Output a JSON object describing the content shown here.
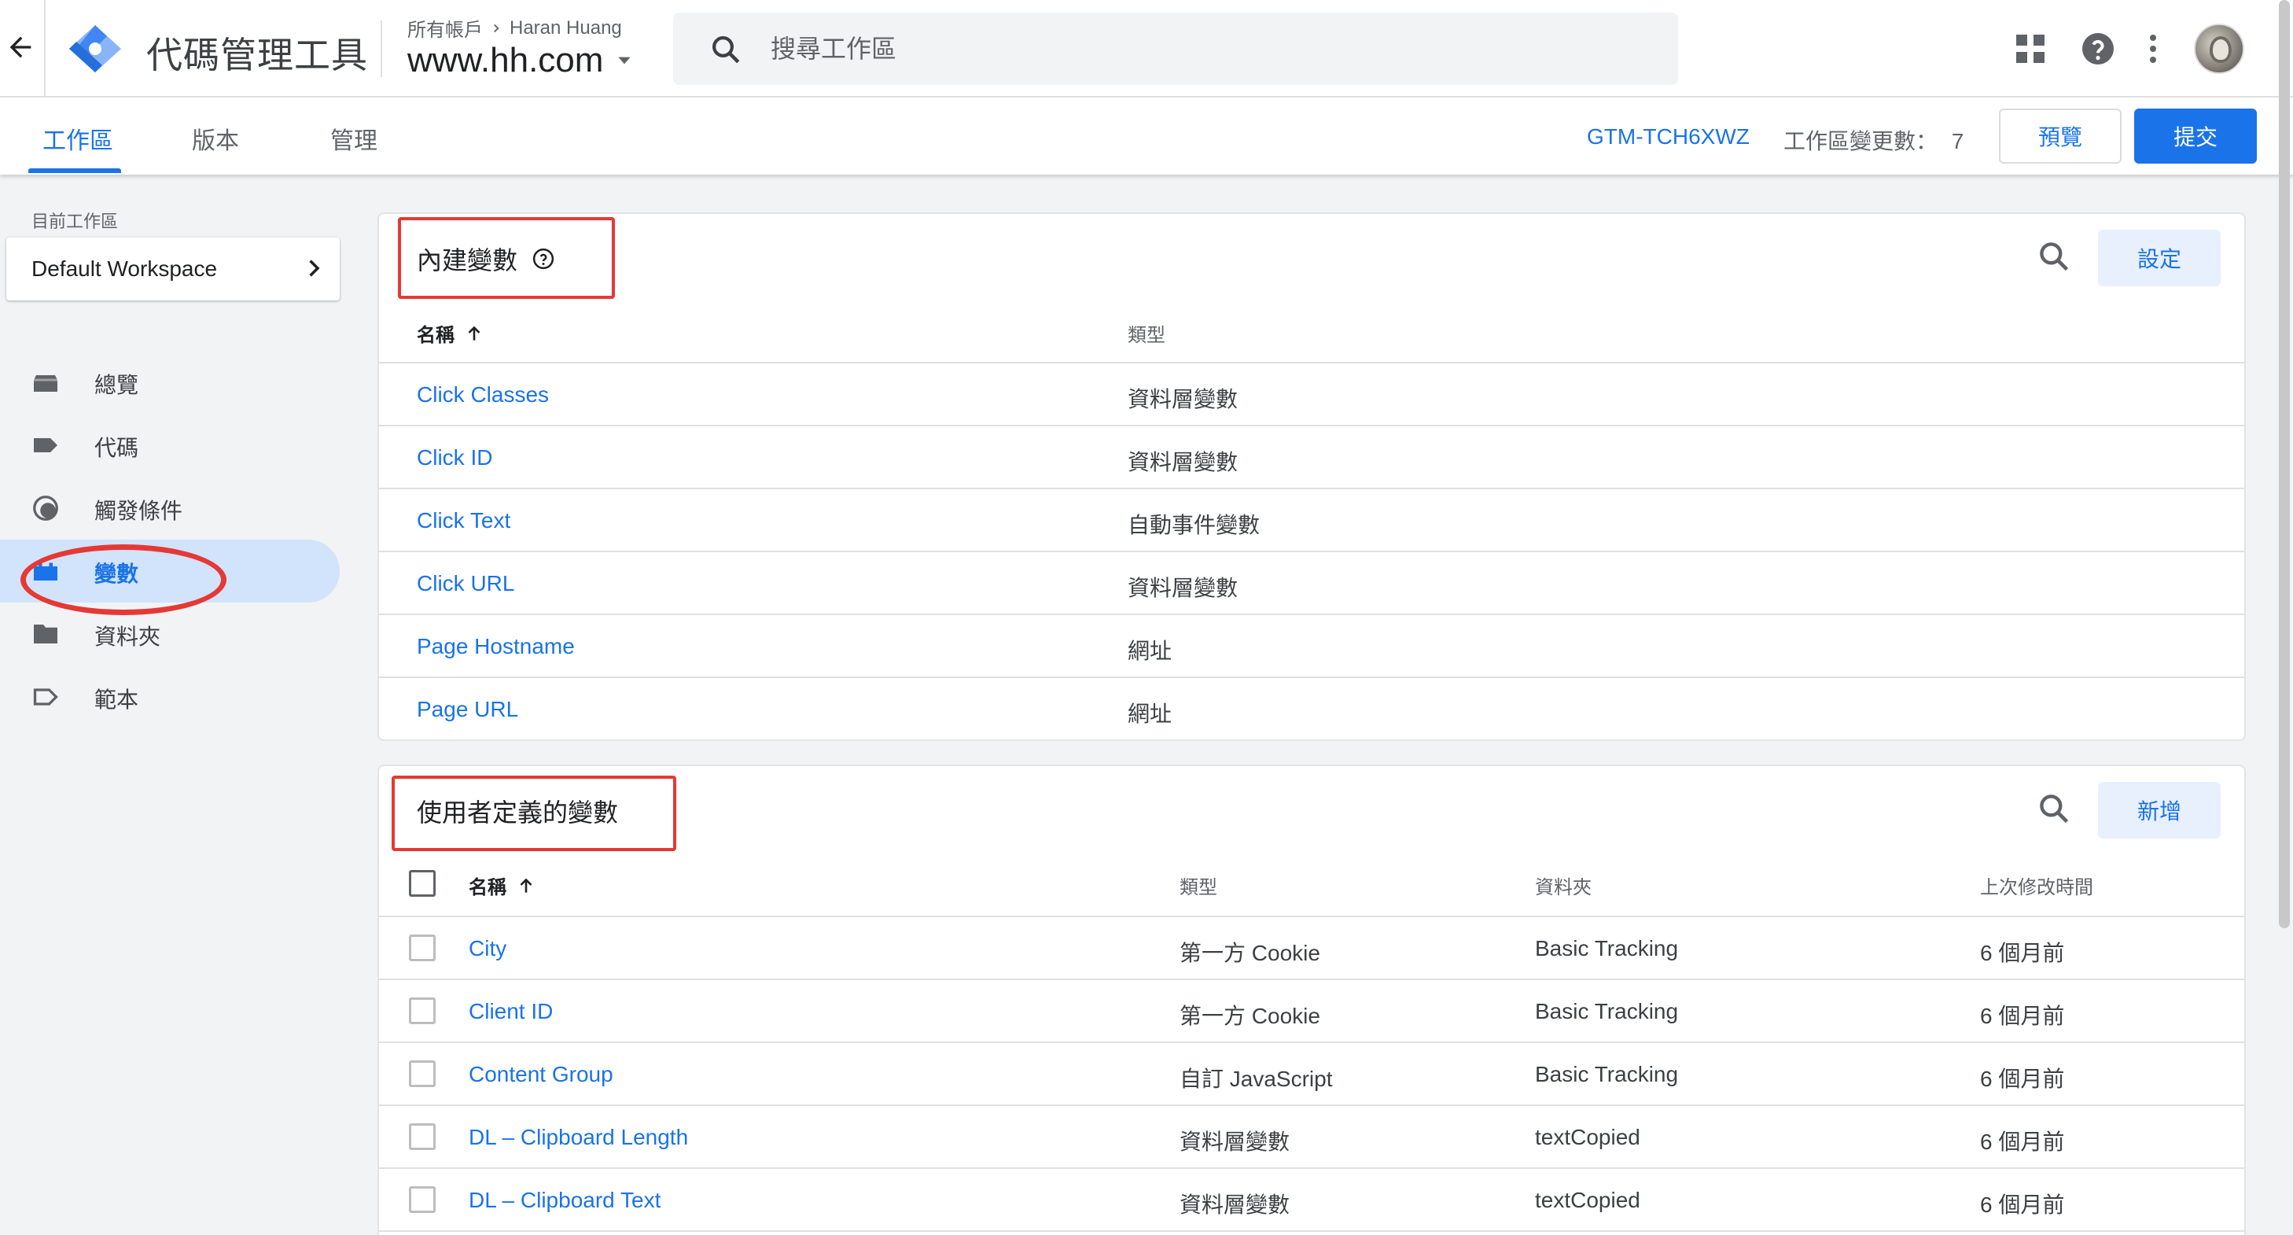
{
  "header": {
    "app_title": "代碼管理工具",
    "breadcrumb_all_accounts": "所有帳戶",
    "breadcrumb_account": "Haran Huang",
    "container": "www.hh.com",
    "search_placeholder": "搜尋工作區"
  },
  "tabs": [
    {
      "label": "工作區",
      "active": true
    },
    {
      "label": "版本",
      "active": false
    },
    {
      "label": "管理",
      "active": false
    }
  ],
  "toolbar": {
    "container_id": "GTM-TCH6XWZ",
    "changes_label": "工作區變更數：",
    "changes_count": "7",
    "preview_label": "預覽",
    "submit_label": "提交"
  },
  "sidebar": {
    "workspace_label": "目前工作區",
    "workspace_name": "Default Workspace",
    "items": [
      {
        "label": "總覽",
        "icon": "overview-icon"
      },
      {
        "label": "代碼",
        "icon": "tag-icon"
      },
      {
        "label": "觸發條件",
        "icon": "trigger-icon"
      },
      {
        "label": "變數",
        "icon": "variable-icon",
        "active": true
      },
      {
        "label": "資料夾",
        "icon": "folder-icon"
      },
      {
        "label": "範本",
        "icon": "template-icon"
      }
    ]
  },
  "builtin": {
    "title": "內建變數",
    "button": "設定",
    "headers": {
      "name": "名稱",
      "type": "類型"
    },
    "rows": [
      {
        "name": "Click Classes",
        "type": "資料層變數"
      },
      {
        "name": "Click ID",
        "type": "資料層變數"
      },
      {
        "name": "Click Text",
        "type": "自動事件變數"
      },
      {
        "name": "Click URL",
        "type": "資料層變數"
      },
      {
        "name": "Page Hostname",
        "type": "網址"
      },
      {
        "name": "Page URL",
        "type": "網址"
      }
    ]
  },
  "user_defined": {
    "title": "使用者定義的變數",
    "button": "新增",
    "headers": {
      "name": "名稱",
      "type": "類型",
      "folder": "資料夾",
      "modified": "上次修改時間"
    },
    "rows": [
      {
        "name": "City",
        "type": "第一方 Cookie",
        "folder": "Basic Tracking",
        "modified": "6 個月前"
      },
      {
        "name": "Client ID",
        "type": "第一方 Cookie",
        "folder": "Basic Tracking",
        "modified": "6 個月前"
      },
      {
        "name": "Content Group",
        "type": "自訂 JavaScript",
        "folder": "Basic Tracking",
        "modified": "6 個月前"
      },
      {
        "name": "DL – Clipboard Length",
        "type": "資料層變數",
        "folder": "textCopied",
        "modified": "6 個月前"
      },
      {
        "name": "DL – Clipboard Text",
        "type": "資料層變數",
        "folder": "textCopied",
        "modified": "6 個月前"
      }
    ]
  },
  "colors": {
    "accent": "#1a73e8",
    "highlight": "#e53935",
    "sidebar_active": "#d2e3fc"
  }
}
